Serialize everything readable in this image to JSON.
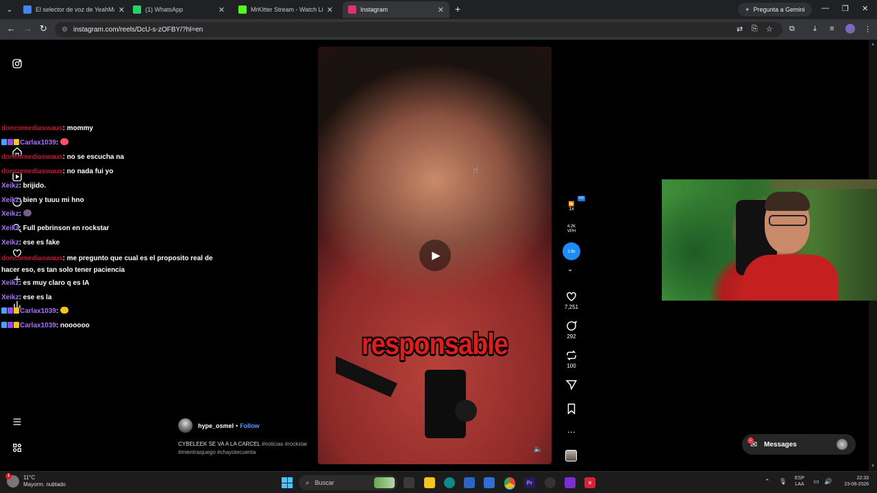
{
  "tabs": [
    {
      "title": "El selector de voz de YeahMayb",
      "favicon_color": "#4285f4"
    },
    {
      "title": "(1) WhatsApp",
      "favicon_color": "#25d366"
    },
    {
      "title": "MrKitter Stream - Watch Live o",
      "favicon_color": "#53fc18"
    },
    {
      "title": "Instagram",
      "favicon_color": "#e1306c"
    }
  ],
  "gemini_label": "Pregunta a Gemini",
  "url": "instagram.com/reels/DcU-s-zOFBY/?hl=en",
  "chat": [
    {
      "user": "doncomediaswaus",
      "user_color": "#c8102e",
      "badges": [],
      "text": ": mommy"
    },
    {
      "user": "Carlax1039",
      "user_color": "#a970ff",
      "badges": [
        "b1",
        "b2",
        "b3"
      ],
      "text": ": ",
      "emote": "#ff4d6d"
    },
    {
      "user": "doncomediaswaus",
      "user_color": "#c8102e",
      "badges": [],
      "text": ": no se escucha na"
    },
    {
      "user": "doncomediaswaus",
      "user_color": "#c8102e",
      "badges": [],
      "text": ": no nada fui yo"
    },
    {
      "user": "Xeikz",
      "user_color": "#a970ff",
      "badges": [],
      "text": ": brijido."
    },
    {
      "user": "Xeikz",
      "user_color": "#a970ff",
      "badges": [],
      "text": ": bien y tuuu mi hno"
    },
    {
      "user": "Xeikz",
      "user_color": "#a970ff",
      "badges": [],
      "text": ": ",
      "emote": "#7a5c8a"
    },
    {
      "user": "Xeikz",
      "user_color": "#a970ff",
      "badges": [],
      "text": ": Full pebrinson en rockstar"
    },
    {
      "user": "Xeikz",
      "user_color": "#a970ff",
      "badges": [],
      "text": ": ese es fake"
    },
    {
      "user": "doncomediaswaus",
      "user_color": "#c8102e",
      "badges": [],
      "text": ": me pregunto que cual es el proposito real de hacer eso, es tan solo tener paciencia",
      "wrap": true
    },
    {
      "user": "Xeikz",
      "user_color": "#a970ff",
      "badges": [],
      "text": ": es muy claro q es IA"
    },
    {
      "user": "Xeikz",
      "user_color": "#a970ff",
      "badges": [],
      "text": ": ese es la"
    },
    {
      "user": "Carlax1039",
      "user_color": "#a970ff",
      "badges": [
        "b1",
        "b2",
        "b3"
      ],
      "text": ": ",
      "emote": "#f5c518"
    },
    {
      "user": "Carlax1039",
      "user_color": "#a970ff",
      "badges": [
        "b1",
        "b2",
        "b3"
      ],
      "text": ": noooooo"
    }
  ],
  "video": {
    "caption": "responsable"
  },
  "extension": {
    "speed": "1x",
    "hd": "HD",
    "vph": "4.2K",
    "vph_unit": "VPH",
    "trend": "2.8x"
  },
  "actions": {
    "likes": "7,251",
    "comments": "292",
    "reposts": "100"
  },
  "author": {
    "name": "hype_osmel",
    "sep": "•",
    "follow": "Follow"
  },
  "description": {
    "title": "CYBELEEK SE VA A LA CARCEL",
    "tags": "#noticias #rockstar #mientrasjuego #chayotecuenta"
  },
  "messages": {
    "label": "Messages",
    "count": "1"
  },
  "weather": {
    "temp": "11°C",
    "desc": "Mayorm. nublado",
    "alerts": "1"
  },
  "taskbar": {
    "search": "Buscar"
  },
  "tray": {
    "lang1": "ESP",
    "lang2": "LAA",
    "time": "22:33",
    "date": "23-08-2026"
  }
}
